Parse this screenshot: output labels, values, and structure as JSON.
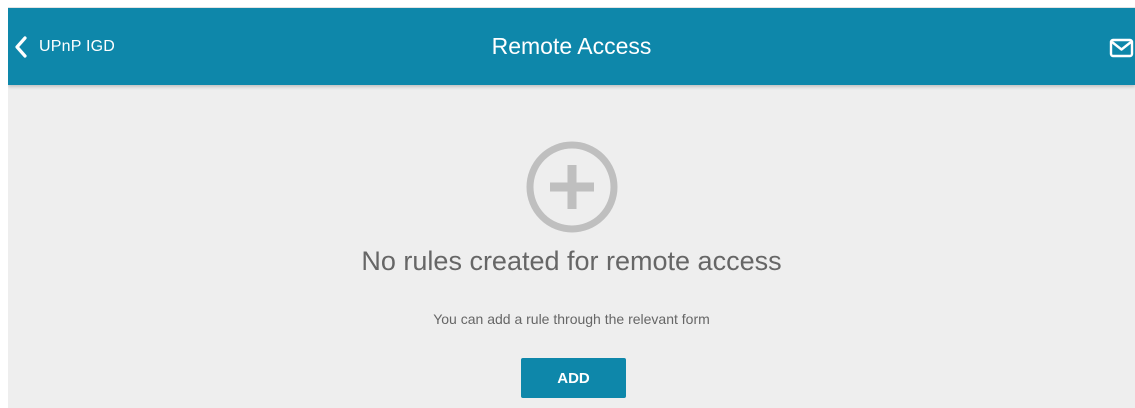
{
  "header": {
    "back_label": "UPnP IGD",
    "title": "Remote Access",
    "back_icon": "chevron-left-icon",
    "notification_icon": "mail-icon"
  },
  "empty_state": {
    "icon": "add-circle-icon",
    "title": "No rules created for remote access",
    "hint": "You can add a rule through the relevant form",
    "add_label": "ADD"
  },
  "colors": {
    "accent": "#0e87aa",
    "background": "#eeeeee",
    "icon_gray": "#bfbfbf",
    "text_gray": "#666666"
  }
}
